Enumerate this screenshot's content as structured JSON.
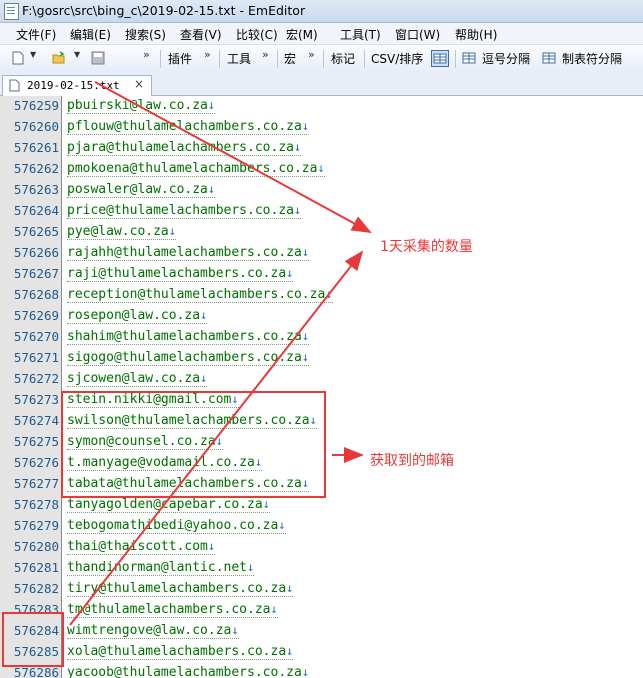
{
  "window": {
    "title": "F:\\gosrc\\src\\bing_c\\2019-02-15.txt - EmEditor"
  },
  "menu": [
    "文件(F)",
    "编辑(E)",
    "搜索(S)",
    "查看(V)",
    "比较(C)",
    "宏(M)",
    "工具(T)",
    "窗口(W)",
    "帮助(H)"
  ],
  "toolbar": {
    "plugins_label": "插件",
    "tools_label": "工具",
    "macros_label": "宏",
    "marks_label": "标记",
    "csv_label": "CSV/排序",
    "comma_label": "逗号分隔",
    "tab_label": "制表符分隔"
  },
  "tab": {
    "label": "2019-02-15.txt",
    "close": "×"
  },
  "lines": [
    {
      "n": "576259",
      "t": "pbuirski@law.co.za"
    },
    {
      "n": "576260",
      "t": "pflouw@thulamelachambers.co.za"
    },
    {
      "n": "576261",
      "t": "pjara@thulamelachambers.co.za"
    },
    {
      "n": "576262",
      "t": "pmokoena@thulamelachambers.co.za"
    },
    {
      "n": "576263",
      "t": "poswaler@law.co.za"
    },
    {
      "n": "576264",
      "t": "price@thulamelachambers.co.za"
    },
    {
      "n": "576265",
      "t": "pye@law.co.za"
    },
    {
      "n": "576266",
      "t": "rajahh@thulamelachambers.co.za"
    },
    {
      "n": "576267",
      "t": "raji@thulamelachambers.co.za"
    },
    {
      "n": "576268",
      "t": "reception@thulamelachambers.co.za"
    },
    {
      "n": "576269",
      "t": "rosepon@law.co.za"
    },
    {
      "n": "576270",
      "t": "shahim@thulamelachambers.co.za"
    },
    {
      "n": "576271",
      "t": "sigogo@thulamelachambers.co.za"
    },
    {
      "n": "576272",
      "t": "sjcowen@law.co.za"
    },
    {
      "n": "576273",
      "t": "stein.nikki@gmail.com"
    },
    {
      "n": "576274",
      "t": "swilson@thulamelachambers.co.za"
    },
    {
      "n": "576275",
      "t": "symon@counsel.co.za"
    },
    {
      "n": "576276",
      "t": "t.manyage@vodamail.co.za"
    },
    {
      "n": "576277",
      "t": "tabata@thulamelachambers.co.za"
    },
    {
      "n": "576278",
      "t": "tanyagolden@capebar.co.za"
    },
    {
      "n": "576279",
      "t": "tebogomathibedi@yahoo.co.za"
    },
    {
      "n": "576280",
      "t": "thai@thaiscott.com"
    },
    {
      "n": "576281",
      "t": "thandinorman@lantic.net"
    },
    {
      "n": "576282",
      "t": "tiry@thulamelachambers.co.za"
    },
    {
      "n": "576283",
      "t": "tm@thulamelachambers.co.za"
    },
    {
      "n": "576284",
      "t": "wimtrengove@law.co.za"
    },
    {
      "n": "576285",
      "t": "xola@thulamelachambers.co.za"
    },
    {
      "n": "576286",
      "t": "yacoob@thulamelachambers.co.za"
    }
  ],
  "eol_mark": "↓",
  "annotations": {
    "daily_count": "1天采集的数量",
    "emails_found": "获取到的邮箱",
    "color": "#e8393a"
  }
}
